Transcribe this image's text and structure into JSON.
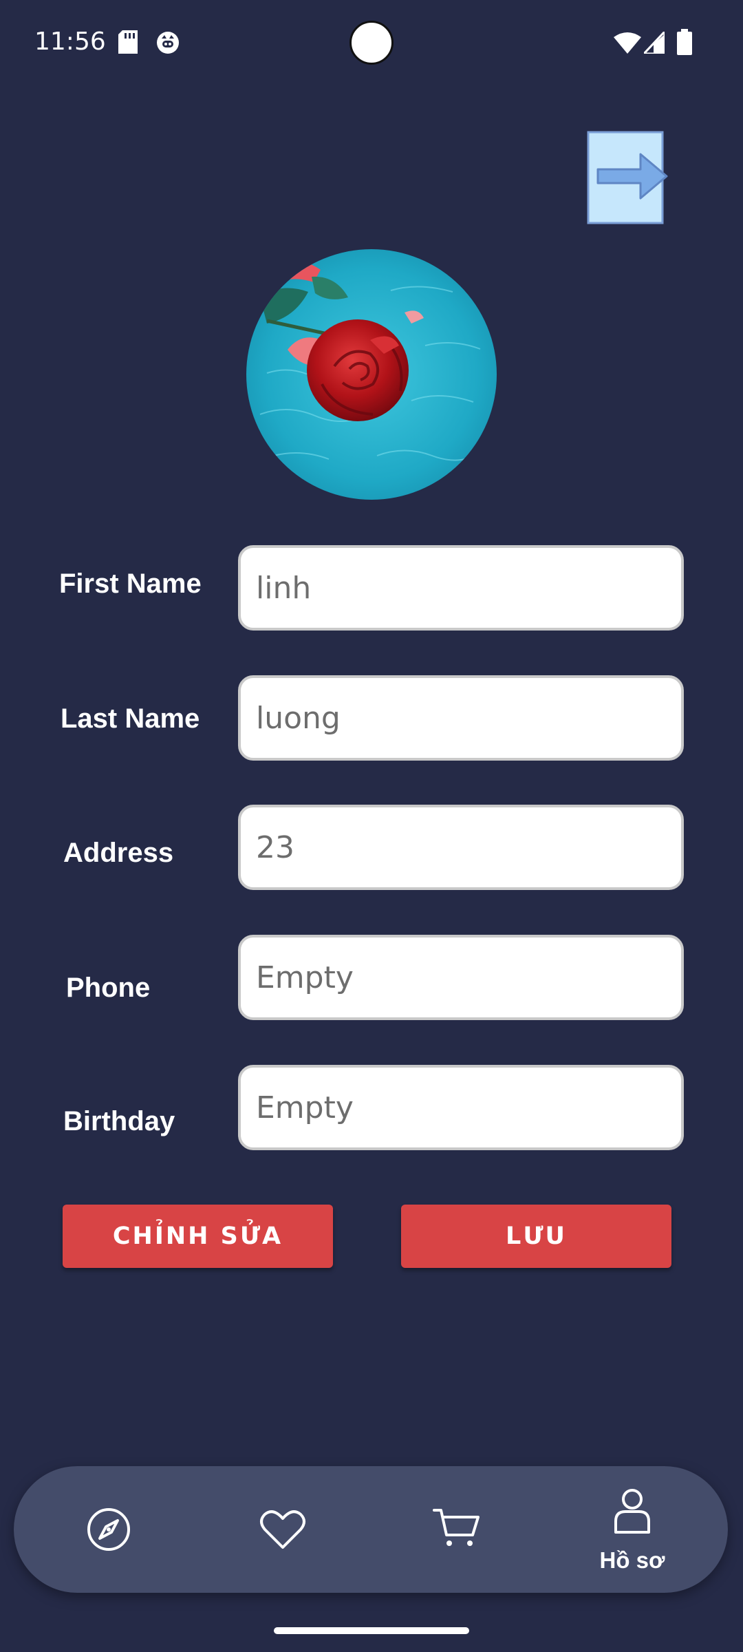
{
  "status_bar": {
    "time": "11:56",
    "icons": [
      "sd-card-icon",
      "app-notification-icon",
      "wifi-icon",
      "cellular-signal-icon",
      "battery-icon"
    ]
  },
  "header": {
    "logout_icon": "logout-arrow-icon"
  },
  "profile": {
    "avatar": "avatar"
  },
  "form": {
    "fields": [
      {
        "label": "First Name",
        "value": "linh",
        "placeholder": ""
      },
      {
        "label": "Last Name",
        "value": "luong",
        "placeholder": ""
      },
      {
        "label": "Address",
        "value": "23",
        "placeholder": ""
      },
      {
        "label": "Phone",
        "value": "",
        "placeholder": "Empty"
      },
      {
        "label": "Birthday",
        "value": "",
        "placeholder": "Empty"
      }
    ]
  },
  "actions": {
    "edit_label": "CHỈNH SỬA",
    "save_label": "LƯU"
  },
  "bottom_nav": {
    "items": [
      {
        "icon": "compass-icon",
        "label": ""
      },
      {
        "icon": "heart-icon",
        "label": ""
      },
      {
        "icon": "cart-icon",
        "label": ""
      },
      {
        "icon": "user-icon",
        "label": "Hồ sơ"
      }
    ]
  },
  "colors": {
    "background": "#252a47",
    "nav_background": "#444c6a",
    "button": "#d84445",
    "input_border": "#c9c9c9"
  }
}
